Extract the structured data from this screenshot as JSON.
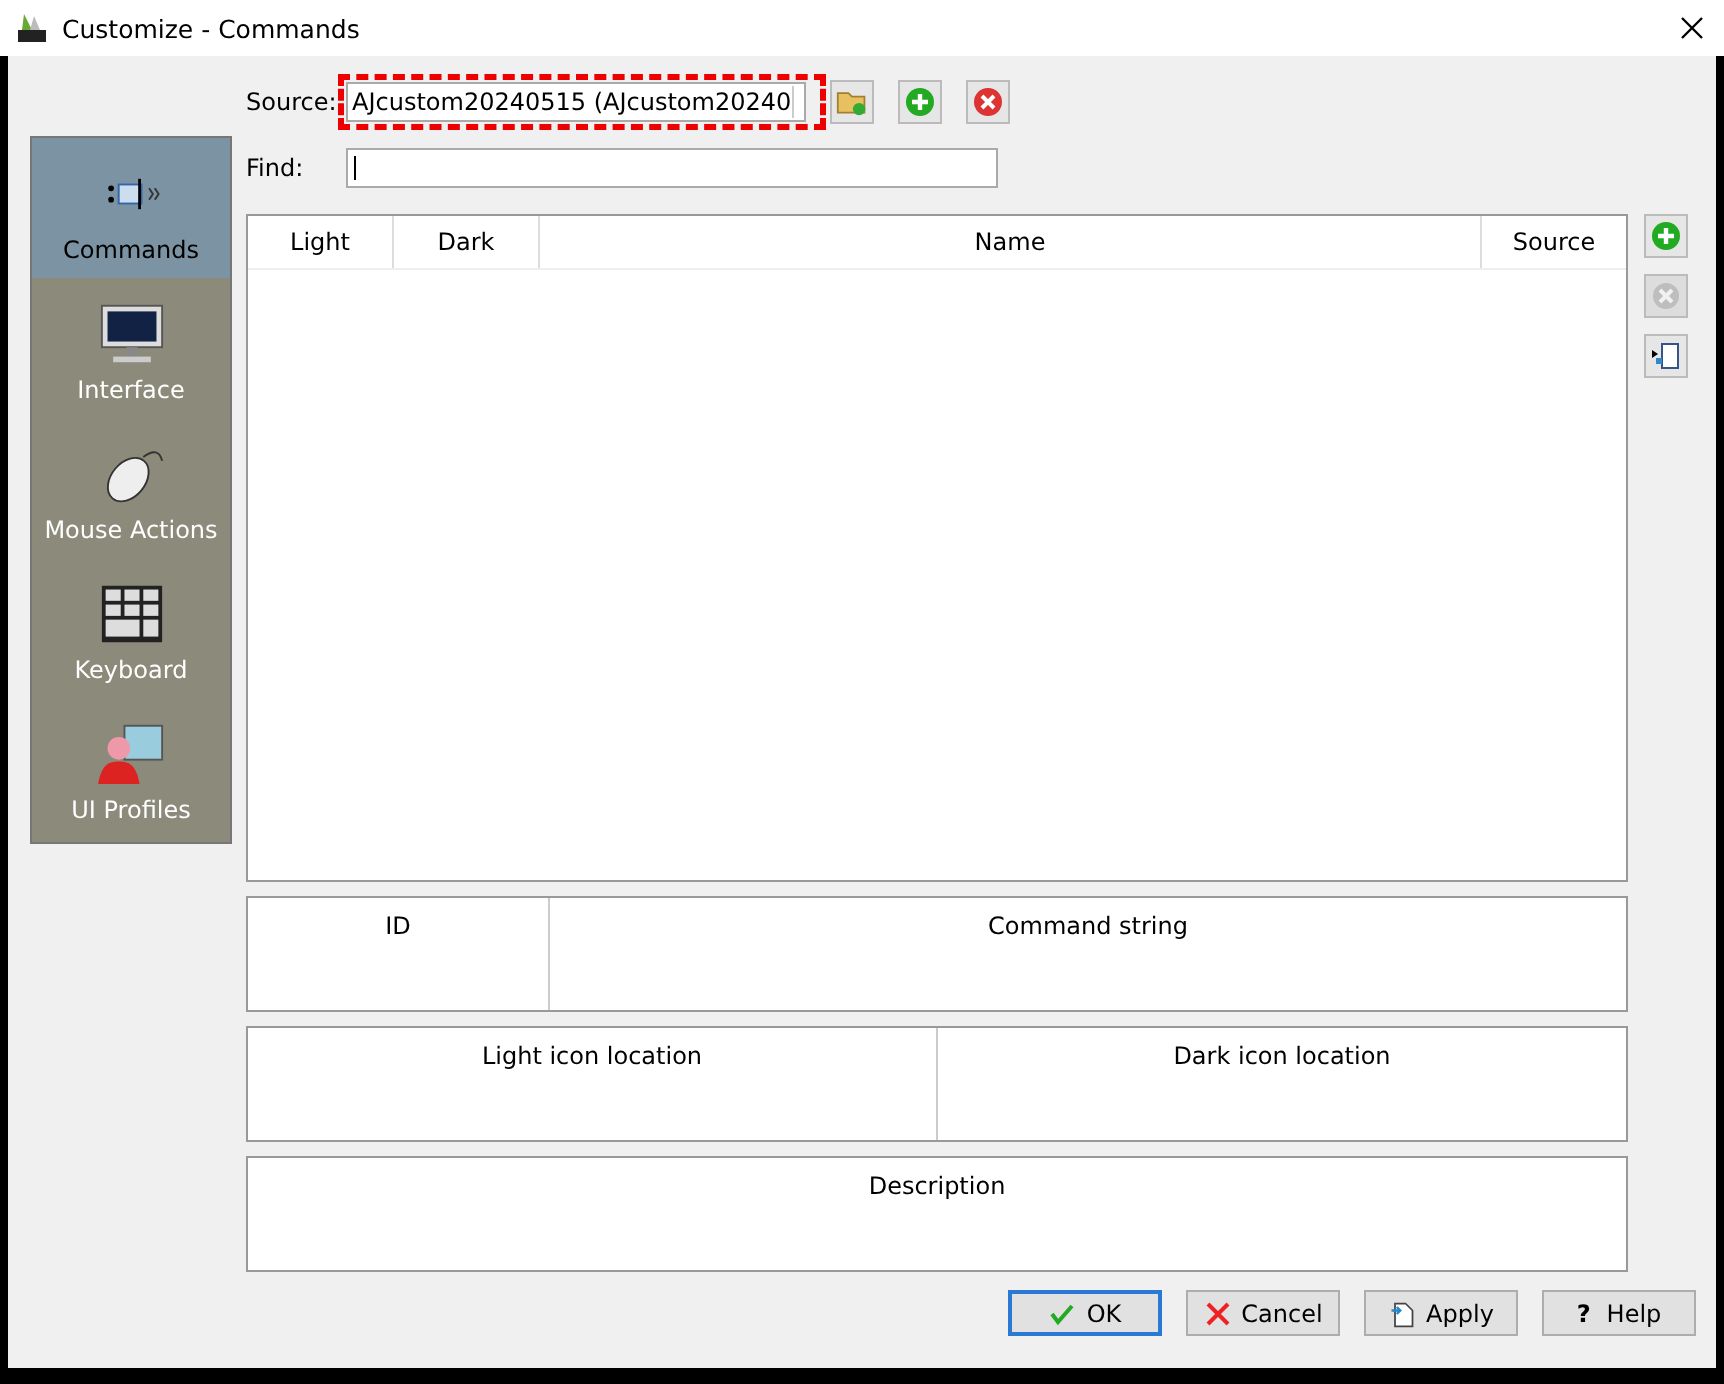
{
  "window": {
    "title": "Customize - Commands"
  },
  "sidebar": {
    "items": [
      {
        "label": "Commands",
        "kind": "commands",
        "selected": true
      },
      {
        "label": "Interface",
        "kind": "monitor",
        "selected": false
      },
      {
        "label": "Mouse Actions",
        "kind": "mouse",
        "selected": false
      },
      {
        "label": "Keyboard",
        "kind": "keyboard",
        "selected": false
      },
      {
        "label": "UI Profiles",
        "kind": "profile",
        "selected": false
      }
    ]
  },
  "source": {
    "label": "Source:",
    "value": "AJcustom20240515 (AJcustom20240",
    "highlighted": true
  },
  "find": {
    "label": "Find:"
  },
  "table": {
    "columns": [
      "Light",
      "Dark",
      "Name",
      "Source"
    ]
  },
  "side_buttons": [
    {
      "kind": "add",
      "disabled": false
    },
    {
      "kind": "remove",
      "disabled": true
    },
    {
      "kind": "copy",
      "disabled": false
    }
  ],
  "details": [
    {
      "fields": [
        "ID",
        "Command string"
      ]
    },
    {
      "fields": [
        "Light icon location",
        "Dark icon location"
      ]
    },
    {
      "fields": [
        "Description"
      ]
    }
  ],
  "buttons": [
    {
      "kind": "ok",
      "label": "OK",
      "default": true
    },
    {
      "kind": "cancel",
      "label": "Cancel",
      "default": false
    },
    {
      "kind": "apply",
      "label": "Apply",
      "default": false
    },
    {
      "kind": "help",
      "label": "Help",
      "glyph": "?",
      "default": false
    }
  ]
}
